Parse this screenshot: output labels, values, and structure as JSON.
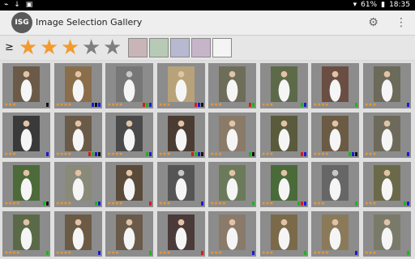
{
  "status_bar": {
    "left_icons": [
      "usb-icon",
      "download-icon",
      "gallery-icon"
    ],
    "battery": "61%",
    "time": "18:35"
  },
  "app_bar": {
    "logo_text": "ISG",
    "title": "Image Selection Gallery",
    "actions": [
      "settings-icon",
      "overflow-menu-icon"
    ]
  },
  "filter_bar": {
    "comparator": "≥",
    "rating": 3,
    "max_rating": 5,
    "color_filters": [
      {
        "name": "red",
        "color": "#c9b4b7",
        "selected": false
      },
      {
        "name": "green",
        "color": "#b7cab5",
        "selected": false
      },
      {
        "name": "blue",
        "color": "#b6b9cf",
        "selected": false
      },
      {
        "name": "purple",
        "color": "#c6b5c9",
        "selected": false
      },
      {
        "name": "none",
        "color": "#f4f4f4",
        "selected": false
      }
    ]
  },
  "gallery": {
    "columns": 8,
    "thumbnails": [
      {
        "rating": 3,
        "tags": [
          "#111"
        ],
        "tone": "#6b5a48",
        "bw": false
      },
      {
        "rating": 4,
        "tags": [
          "#1b1bd6",
          "#111",
          "#1b1bd6"
        ],
        "tone": "#8a6d4a",
        "bw": false
      },
      {
        "rating": 4,
        "tags": [
          "#d91b1b",
          "#1bb51b",
          "#1b1bd6"
        ],
        "tone": "#777",
        "bw": true
      },
      {
        "rating": 3,
        "tags": [
          "#d91b1b",
          "#1b1bd6",
          "#111"
        ],
        "tone": "#b8a27a",
        "bw": false
      },
      {
        "rating": 3,
        "tags": [
          "#d91b1b",
          "#1bb51b"
        ],
        "tone": "#6d6d5a",
        "bw": false
      },
      {
        "rating": 3,
        "tags": [
          "#1bb51b",
          "#1b1bd6"
        ],
        "tone": "#5d6a4a",
        "bw": false
      },
      {
        "rating": 4,
        "tags": [
          "#1bb51b"
        ],
        "tone": "#6a4e43",
        "bw": false
      },
      {
        "rating": 3,
        "tags": [
          "#1b1bd6"
        ],
        "tone": "#6b6a5b",
        "bw": false
      },
      {
        "rating": 3,
        "tags": [
          "#1b1bd6"
        ],
        "tone": "#3a3a3a",
        "bw": false
      },
      {
        "rating": 4,
        "tags": [
          "#d91b1b",
          "#1bb51b",
          "#1b1bd6",
          "#111"
        ],
        "tone": "#6a5a48",
        "bw": false
      },
      {
        "rating": 4,
        "tags": [
          "#1bb51b",
          "#1b1bd6"
        ],
        "tone": "#4a4a4a",
        "bw": false
      },
      {
        "rating": 3,
        "tags": [
          "#d91b1b",
          "#1bb51b",
          "#1b1bd6",
          "#111"
        ],
        "tone": "#4b3c33",
        "bw": false
      },
      {
        "rating": 3,
        "tags": [
          "#1bb51b",
          "#111"
        ],
        "tone": "#8a7a68",
        "bw": false
      },
      {
        "rating": 3,
        "tags": [
          "#d91b1b",
          "#1b1bd6"
        ],
        "tone": "#5a5a3c",
        "bw": false
      },
      {
        "rating": 4,
        "tags": [
          "#1bb51b",
          "#1b1bd6",
          "#111"
        ],
        "tone": "#6b5b45",
        "bw": false
      },
      {
        "rating": 3,
        "tags": [
          "#1b1bd6"
        ],
        "tone": "#6d6a5b",
        "bw": false
      },
      {
        "rating": 4,
        "tags": [
          "#1bb51b",
          "#111"
        ],
        "tone": "#4d6a3a",
        "bw": false
      },
      {
        "rating": 4,
        "tags": [
          "#1bb51b",
          "#1b1bd6"
        ],
        "tone": "#8a8a7a",
        "bw": false
      },
      {
        "rating": 4,
        "tags": [
          "#d91b1b"
        ],
        "tone": "#5a4a3a",
        "bw": false
      },
      {
        "rating": 3,
        "tags": [
          "#1b1bd6"
        ],
        "tone": "#555",
        "bw": true
      },
      {
        "rating": 4,
        "tags": [
          "#1bb51b"
        ],
        "tone": "#6a7a5a",
        "bw": false
      },
      {
        "rating": 3,
        "tags": [
          "#1bb51b",
          "#d91b1b",
          "#1b1bd6"
        ],
        "tone": "#4a6a3a",
        "bw": false
      },
      {
        "rating": 3,
        "tags": [
          "#1bb51b"
        ],
        "tone": "#666",
        "bw": true
      },
      {
        "rating": 3,
        "tags": [
          "#1bb51b",
          "#1b1bd6"
        ],
        "tone": "#6a6a4a",
        "bw": false
      },
      {
        "rating": 4,
        "tags": [
          "#1bb51b"
        ],
        "tone": "#5a6a48",
        "bw": false
      },
      {
        "rating": 4,
        "tags": [
          "#1b1bd6"
        ],
        "tone": "#6b5a45",
        "bw": false
      },
      {
        "rating": 3,
        "tags": [
          "#1bb51b"
        ],
        "tone": "#6a5a4a",
        "bw": false
      },
      {
        "rating": 3,
        "tags": [
          "#d91b1b"
        ],
        "tone": "#4a3a3a",
        "bw": false
      },
      {
        "rating": 3,
        "tags": [
          "#1b1bd6"
        ],
        "tone": "#8a7a6a",
        "bw": false
      },
      {
        "rating": 3,
        "tags": [
          "#1bb51b"
        ],
        "tone": "#7a6a4a",
        "bw": false
      },
      {
        "rating": 4,
        "tags": [
          "#1b1bd6"
        ],
        "tone": "#8a7a5a",
        "bw": false
      },
      {
        "rating": 3,
        "tags": [
          "#1bb51b"
        ],
        "tone": "#7a7a6a",
        "bw": false
      }
    ]
  }
}
